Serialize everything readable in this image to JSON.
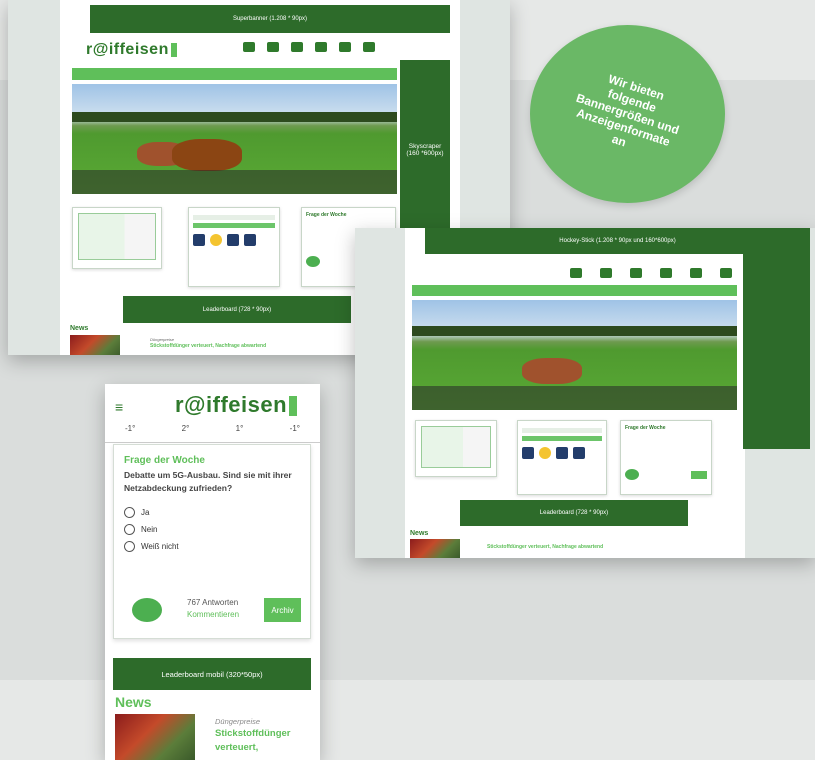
{
  "badge": {
    "lines": [
      "Wir bieten",
      "folgende",
      "Bannergrößen und",
      "Anzeigenformate",
      "an"
    ]
  },
  "shot1": {
    "superbanner": "Superbanner (1.208 * 90px)",
    "skyscraper": [
      "Skyscraper",
      "(160 *600px)"
    ],
    "leaderboard": "Leaderboard (728 * 90px)",
    "news_heading": "News",
    "news_category": "Düngerpreise",
    "news_title": "Stickstoffdünger verteuert, Nachfrage abwartend",
    "poll_title": "Frage der Woche"
  },
  "shot2": {
    "hockey": "Hockey-Stick (1.208 * 90px und 160*600px)",
    "leaderboard": "Leaderboard (728 * 90px)",
    "news_heading": "News",
    "news_title": "Stickstoffdünger verteuert, Nachfrage abwartend",
    "poll_title": "Frage der Woche"
  },
  "mobile": {
    "logo": "r@iffeisen",
    "temps": [
      "-1°",
      "2°",
      "1°",
      "-1°"
    ],
    "poll_title": "Frage der Woche",
    "poll_question": "Debatte um 5G-Ausbau. Sind sie mit ihrer Netzabdeckung zufrieden?",
    "options": [
      "Ja",
      "Nein",
      "Weiß nicht"
    ],
    "answers": "767 Antworten",
    "comment": "Kommentieren",
    "archive": "Archiv",
    "leaderboard": "Leaderboard mobil (320*50px)",
    "news_heading": "News",
    "news_category": "Düngerpreise",
    "news_title_lines": [
      "Stickstoffdünger",
      "verteuert,"
    ]
  },
  "logo_text": "r@iffeisen",
  "colors": {
    "dark_green": "#2d6b2a",
    "mid_green": "#5fbf5a",
    "badge_green": "#6ab866"
  }
}
